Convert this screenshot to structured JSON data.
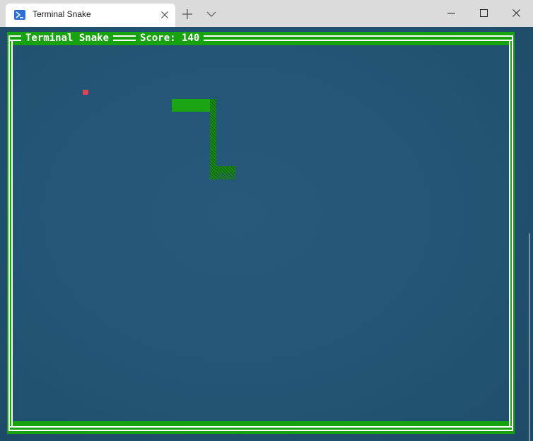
{
  "window": {
    "tab_title": "Terminal Snake",
    "tab_icon": "powershell-icon",
    "controls": [
      "new-tab",
      "tab-dropdown",
      "minimize",
      "maximize",
      "close"
    ]
  },
  "game": {
    "title": "Terminal Snake",
    "score_label": "Score: 140",
    "colors": {
      "frame": "#16a30f",
      "frame_line": "#ffffff",
      "background": "#245a7a",
      "snake": "#1ba414",
      "food": "#e04656"
    }
  }
}
